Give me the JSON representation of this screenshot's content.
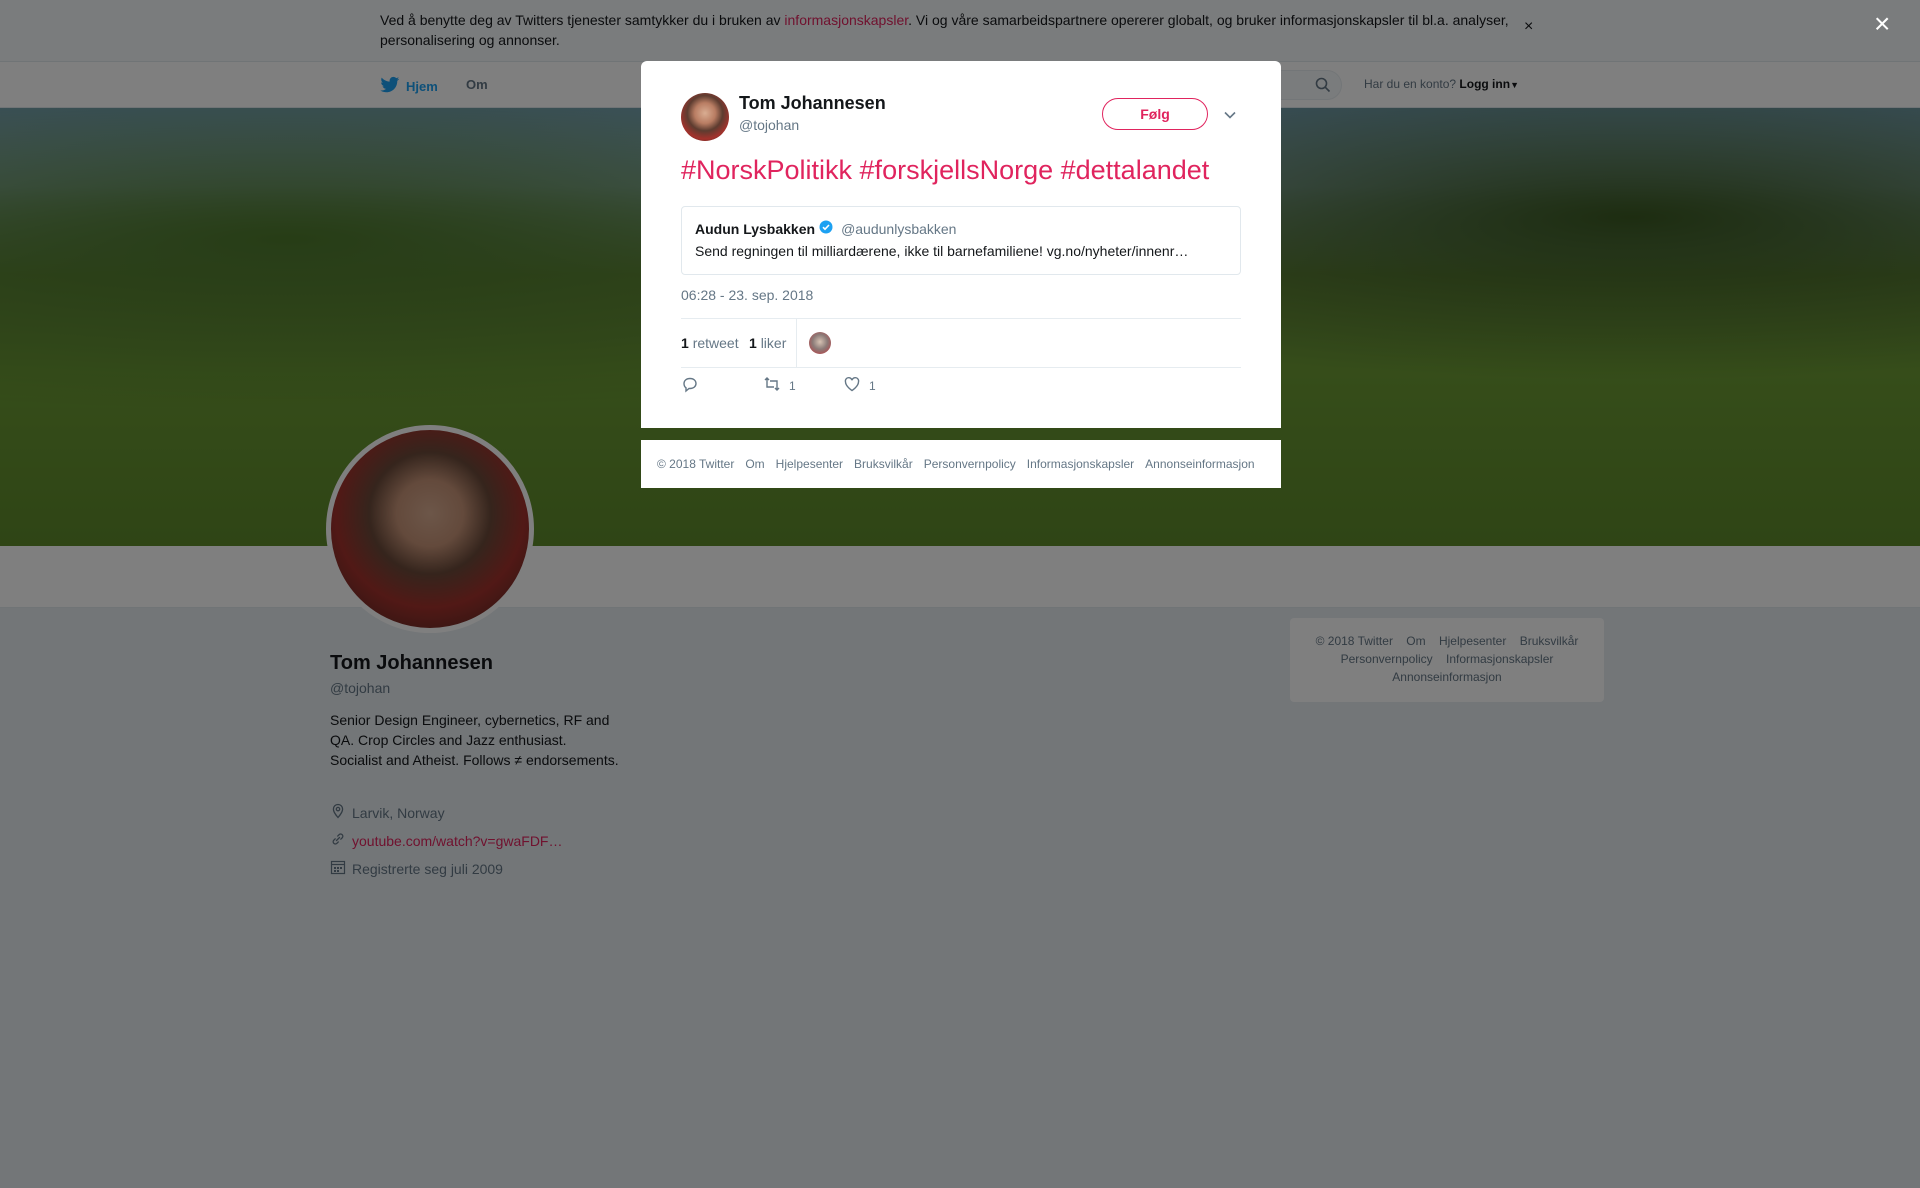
{
  "cookie": {
    "text_before": "Ved å benytte deg av Twitters tjenester samtykker du i bruken av ",
    "link": "informasjonskapsler",
    "text_after": ". Vi og våre samarbeidspartnere opererer globalt, og bruker informasjonskapsler til bl.a. analyser, personalisering og annonser.",
    "close": "×"
  },
  "nav": {
    "home": "Hjem",
    "about": "Om",
    "login_prompt": "Har du en konto?",
    "login": "Logg inn"
  },
  "profile": {
    "name": "Tom Johannesen",
    "handle": "@tojohan",
    "bio": "Senior Design Engineer, cybernetics, RF and QA. Crop Circles and Jazz enthusiast. Socialist and Atheist. Follows ≠ endorsements.",
    "location": "Larvik, Norway",
    "link": "youtube.com/watch?v=gwaFDF…",
    "joined": "Registrerte seg juli 2009"
  },
  "right_footer": {
    "row1": [
      "© 2018 Twitter",
      "Om",
      "Hjelpesenter",
      "Bruksvilkår"
    ],
    "row2": [
      "Personvernpolicy",
      "Informasjonskapsler"
    ],
    "row3": [
      "Annonseinformasjon"
    ]
  },
  "overlay": {
    "close": "×"
  },
  "tweet": {
    "author_name": "Tom Johannesen",
    "author_handle": "@tojohan",
    "follow_label": "Følg",
    "text": "#NorskPolitikk #forskjellsNorge #dettalandet",
    "quote": {
      "name": "Audun Lysbakken",
      "handle": "@audunlysbakken",
      "text": "Send regningen til milliardærene, ikke til barnefamiliene! vg.no/nyheter/innenr…"
    },
    "timestamp": "06:28 - 23. sep. 2018",
    "retweet_count": "1",
    "retweet_label": "retweet",
    "like_count": "1",
    "like_label": "liker",
    "action_retweets": "1",
    "action_likes": "1"
  },
  "modal_footer": [
    "© 2018 Twitter",
    "Om",
    "Hjelpesenter",
    "Bruksvilkår",
    "Personvernpolicy",
    "Informasjonskapsler",
    "Annonseinformasjon"
  ],
  "colors": {
    "accent": "#e0245e",
    "twitter_blue": "#1da1f2",
    "muted": "#657786",
    "bg": "#e6ecf0"
  },
  "icons": [
    "twitter-bird-icon",
    "search-icon",
    "caret-down-icon",
    "close-icon",
    "chevron-down-icon",
    "verified-icon",
    "location-icon",
    "link-icon",
    "calendar-icon",
    "reply-icon",
    "retweet-icon",
    "heart-icon"
  ]
}
